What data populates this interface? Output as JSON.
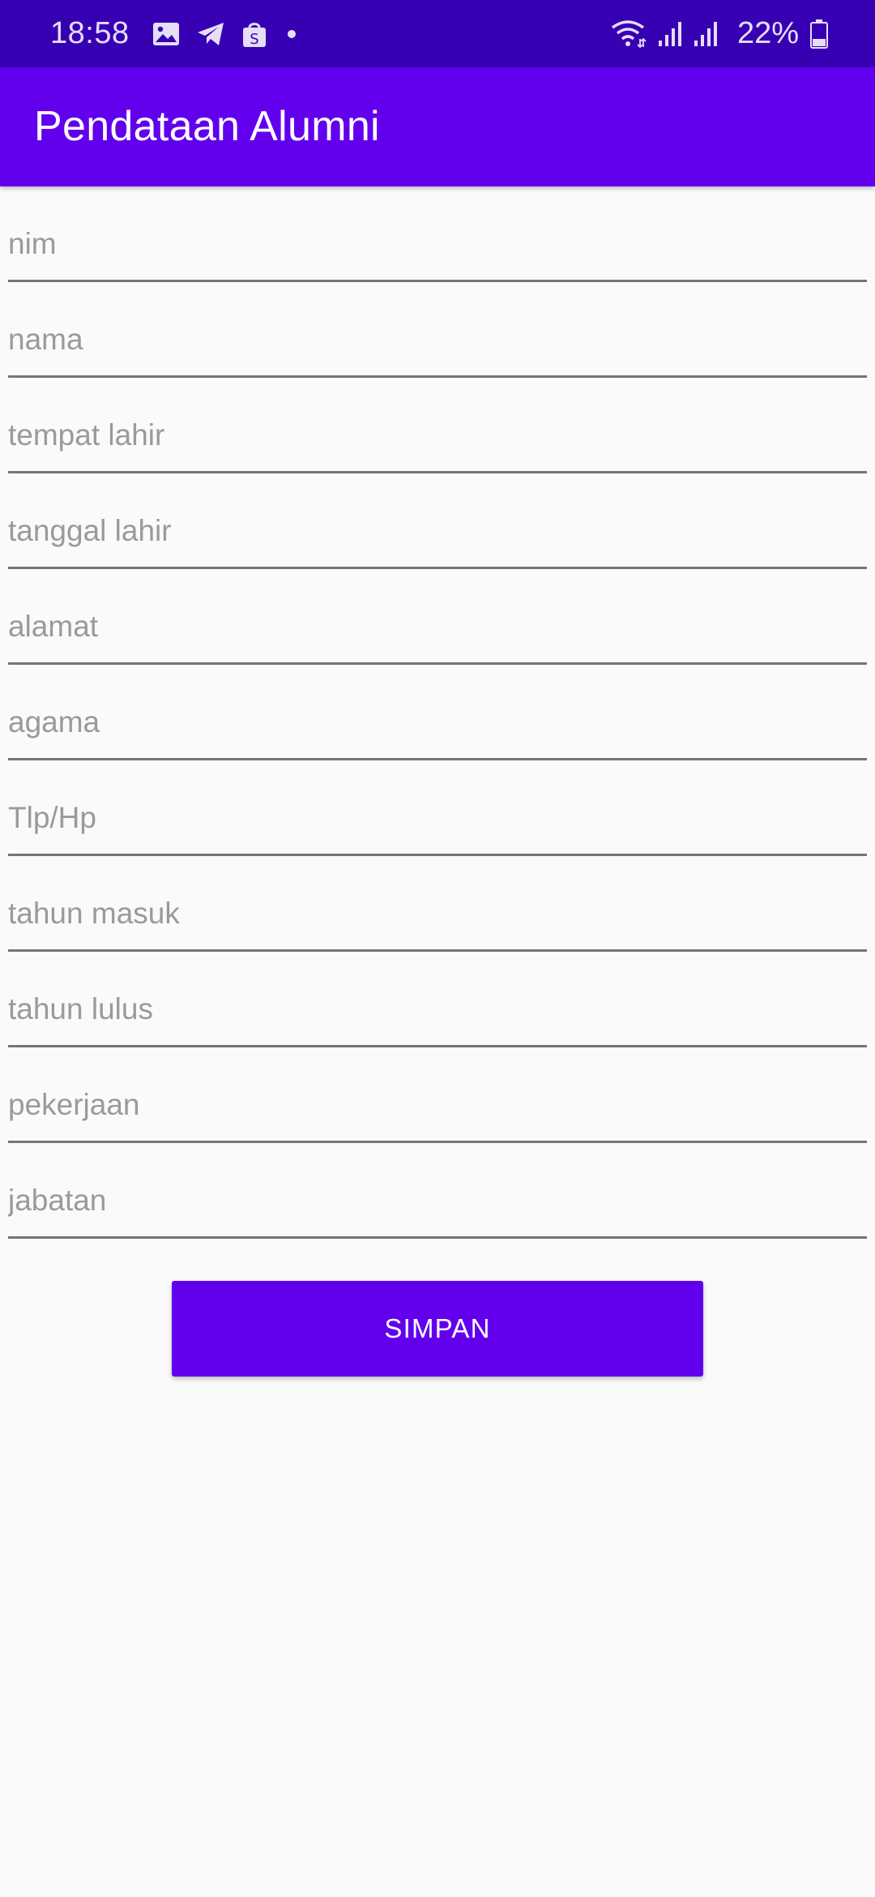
{
  "status_bar": {
    "time": "18:58",
    "battery_percent": "22%",
    "notification_icons": [
      "image-icon",
      "telegram-icon",
      "shop-bag-icon",
      "dot-icon"
    ],
    "system_icons": [
      "wifi-icon",
      "signal-icon",
      "signal-icon",
      "battery-icon"
    ]
  },
  "app_bar": {
    "title": "Pendataan Alumni"
  },
  "form": {
    "fields": [
      {
        "placeholder": "nim",
        "value": ""
      },
      {
        "placeholder": "nama",
        "value": ""
      },
      {
        "placeholder": "tempat lahir",
        "value": ""
      },
      {
        "placeholder": "tanggal lahir",
        "value": ""
      },
      {
        "placeholder": "alamat",
        "value": ""
      },
      {
        "placeholder": "agama",
        "value": ""
      },
      {
        "placeholder": "Tlp/Hp",
        "value": ""
      },
      {
        "placeholder": "tahun masuk",
        "value": ""
      },
      {
        "placeholder": "tahun lulus",
        "value": ""
      },
      {
        "placeholder": "pekerjaan",
        "value": ""
      },
      {
        "placeholder": "jabatan",
        "value": ""
      }
    ],
    "submit_label": "SIMPAN"
  },
  "colors": {
    "status_bar": "#3700B3",
    "primary": "#6200EE",
    "background": "#FAFAFA",
    "underline": "#757575",
    "placeholder": "#9A9A9A"
  }
}
